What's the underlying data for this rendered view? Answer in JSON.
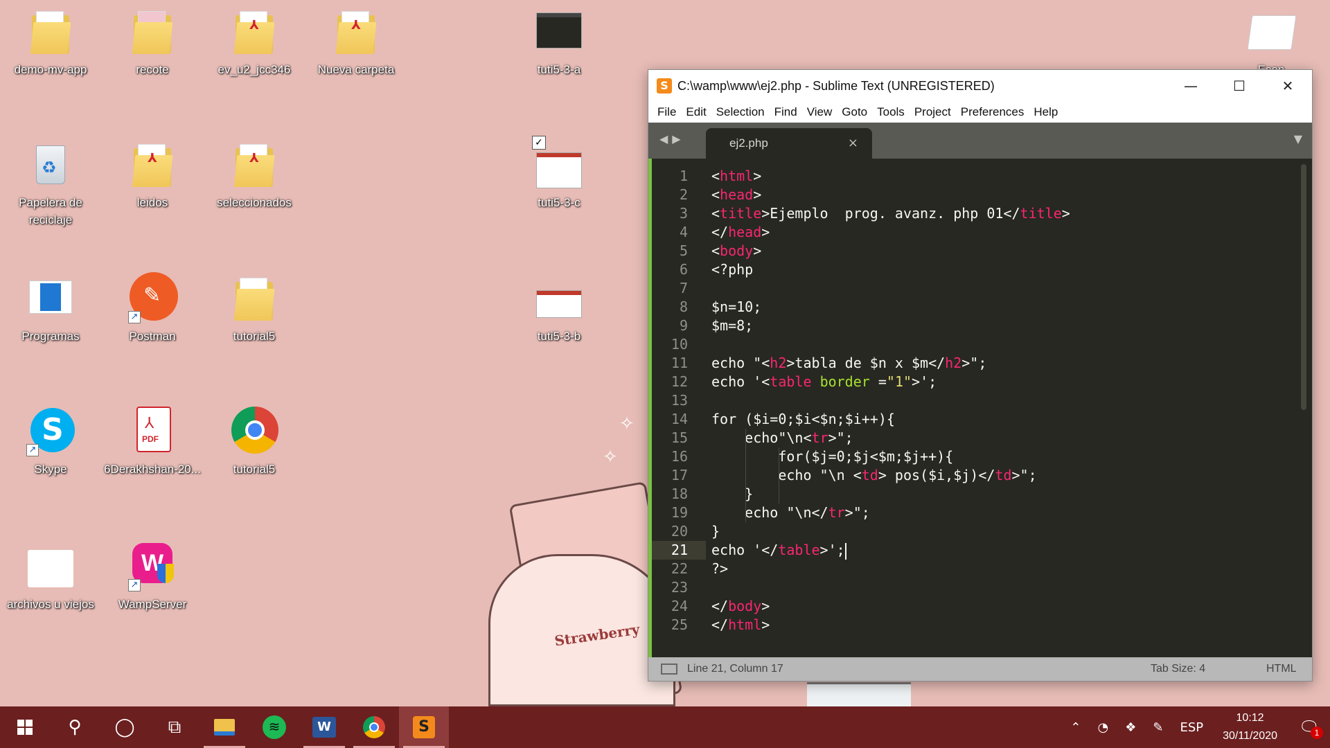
{
  "desktop": {
    "icons": [
      {
        "label": "demo-mv-app",
        "kind": "folder"
      },
      {
        "label": "recote",
        "kind": "folder"
      },
      {
        "label": "ev_u2_jcc346",
        "kind": "pdf-folder"
      },
      {
        "label": "Nueva carpeta",
        "kind": "pdf-folder"
      },
      {
        "label": "tuti5-3-a",
        "kind": "screenshot"
      },
      {
        "label": "Papelera de reciclaje",
        "kind": "recycle-bin"
      },
      {
        "label": "leidos",
        "kind": "pdf-folder"
      },
      {
        "label": "seleccionados",
        "kind": "pdf-folder"
      },
      {
        "label": "tuti5-3-c",
        "kind": "screenshot"
      },
      {
        "label": "Programas",
        "kind": "app"
      },
      {
        "label": "Postman",
        "kind": "shortcut"
      },
      {
        "label": "tutorial5",
        "kind": "folder"
      },
      {
        "label": "tuti5-3-b",
        "kind": "screenshot"
      },
      {
        "label": "Skype",
        "kind": "shortcut"
      },
      {
        "label": "6Derakhshan-20...",
        "kind": "pdf"
      },
      {
        "label": "tutorial5",
        "kind": "chrome-shortcut"
      },
      {
        "label": "archivos u viejos",
        "kind": "folder"
      },
      {
        "label": "WampServer",
        "kind": "shortcut"
      },
      {
        "label": "Econ",
        "kind": "folder"
      }
    ],
    "wallpaper_text": "Strawberry"
  },
  "window": {
    "title": "C:\\wamp\\www\\ej2.php - Sublime Text (UNREGISTERED)",
    "controls": {
      "minimize": "—",
      "maximize": "☐",
      "close": "✕"
    },
    "menu": [
      "File",
      "Edit",
      "Selection",
      "Find",
      "View",
      "Goto",
      "Tools",
      "Project",
      "Preferences",
      "Help"
    ],
    "tab": {
      "name": "ej2.php",
      "close": "×"
    },
    "code_lines": [
      "<html>",
      "<head>",
      "<title>Ejemplo  prog. avanz. php 01</title>",
      "</head>",
      "<body>",
      "<?php",
      "",
      "$n=10;",
      "$m=8;",
      "",
      "echo \"<h2>tabla de $n x $m</h2>\";",
      "echo '<table border =\"1\">';",
      "",
      "for ($i=0;$i<$n;$i++){",
      "    echo\"\\n<tr>\";",
      "        for($j=0;$j<$m;$j++){",
      "        echo \"\\n <td> pos($i,$j)</td>\";",
      "    }",
      "    echo \"\\n</tr>\";",
      "}",
      "echo '</table>';",
      "?>",
      "",
      "</body>",
      "</html>"
    ],
    "current_line": 21,
    "status": {
      "position": "Line 21, Column 17",
      "tab_size": "Tab Size: 4",
      "syntax": "HTML"
    }
  },
  "taskbar": {
    "apps": [
      "start",
      "search",
      "cortana",
      "task-view",
      "file-explorer",
      "spotify",
      "word",
      "chrome",
      "sublime-text"
    ],
    "active": "sublime-text",
    "language": "ESP",
    "time": "10:12",
    "date": "30/11/2020",
    "notification_count": "1"
  },
  "colors": {
    "desktop_bg": "#e7bcb6",
    "taskbar_bg": "#6b1f1f",
    "editor_bg": "#272822",
    "tag": "#f92672",
    "attribute": "#a6e22e",
    "string": "#e6db74"
  }
}
